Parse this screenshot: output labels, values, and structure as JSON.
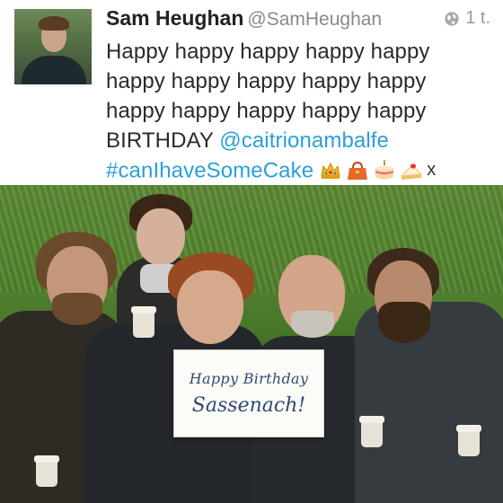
{
  "tweet": {
    "author_name": "Sam Heughan",
    "author_handle": "@SamHeughan",
    "time_ago": "1 t.",
    "lines": [
      "Happy happy happy happy happy",
      "happy happy happy happy happy",
      "happy happy happy happy happy"
    ],
    "line4_prefix": "BIRTHDAY ",
    "mention": "@caitrionambalfe",
    "hashtag": "#canIhaveSomeCake",
    "emoji_names": [
      "crown-icon",
      "handbag-icon",
      "birthday-cake-icon",
      "shortcake-icon"
    ],
    "trailing": "x",
    "link_color": "#2b9fd9"
  },
  "photo": {
    "sign_line1": "Happy Birthday",
    "sign_line2": "Sassenach!"
  }
}
